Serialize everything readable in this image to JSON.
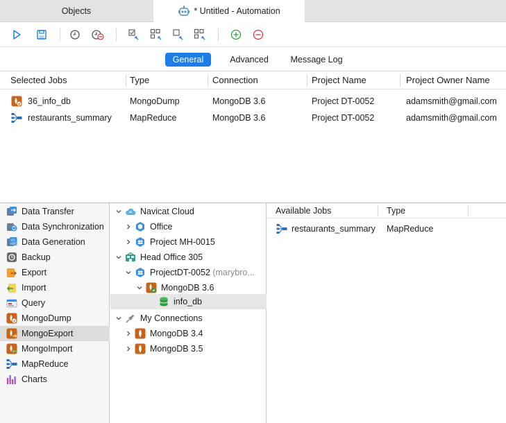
{
  "tabs": [
    {
      "label": "Objects",
      "icon": "none"
    },
    {
      "label": "* Untitled - Automation",
      "icon": "robot-icon"
    }
  ],
  "toolbar": {
    "buttons": [
      "run-icon",
      "save-icon",
      "schedule-icon",
      "delete-schedule-icon",
      "select-all-icon",
      "deselect-all-icon",
      "select-icon",
      "deselect-icon",
      "add-icon",
      "remove-icon"
    ]
  },
  "segments": {
    "general": "General",
    "advanced": "Advanced",
    "message_log": "Message Log",
    "active": "General"
  },
  "jobs_table": {
    "columns": [
      "Selected Jobs",
      "Type",
      "Connection",
      "Project Name",
      "Project Owner Name"
    ],
    "rows": [
      {
        "name": "36_info_db",
        "type": "MongoDump",
        "connection": "MongoDB 3.6",
        "project": "Project DT-0052",
        "owner": "adamsmith@gmail.com",
        "icon": "mongodump-icon"
      },
      {
        "name": "restaurants_summary",
        "type": "MapReduce",
        "connection": "MongoDB 3.6",
        "project": "Project DT-0052",
        "owner": "adamsmith@gmail.com",
        "icon": "mapreduce-icon"
      }
    ]
  },
  "job_types": [
    {
      "label": "Data Transfer",
      "icon": "data-transfer-icon"
    },
    {
      "label": "Data Synchronization",
      "icon": "data-sync-icon"
    },
    {
      "label": "Data Generation",
      "icon": "data-generation-icon"
    },
    {
      "label": "Backup",
      "icon": "backup-icon"
    },
    {
      "label": "Export",
      "icon": "export-icon"
    },
    {
      "label": "Import",
      "icon": "import-icon"
    },
    {
      "label": "Query",
      "icon": "query-icon"
    },
    {
      "label": "MongoDump",
      "icon": "mongodump-icon"
    },
    {
      "label": "MongoExport",
      "icon": "mongoexport-icon",
      "selected": true
    },
    {
      "label": "MongoImport",
      "icon": "mongoimport-icon"
    },
    {
      "label": "MapReduce",
      "icon": "mapreduce-icon"
    },
    {
      "label": "Charts",
      "icon": "charts-icon"
    }
  ],
  "tree": {
    "navicat_cloud": "Navicat Cloud",
    "office": "Office",
    "project_mh": "Project MH-0015",
    "head_office": "Head Office 305",
    "project_dt": "ProjectDT-0052",
    "project_dt_owner": "(marybro...",
    "mongodb_36": "MongoDB 3.6",
    "info_db": "info_db",
    "my_connections": "My Connections",
    "mongodb_34": "MongoDB 3.4",
    "mongodb_35": "MongoDB 3.5"
  },
  "available_jobs": {
    "columns": [
      "Available Jobs",
      "Type"
    ],
    "rows": [
      {
        "name": "restaurants_summary",
        "type": "MapReduce",
        "icon": "mapreduce-icon"
      }
    ]
  },
  "colors": {
    "accent": "#1e7de8",
    "mongo_orange": "#c7641a",
    "green": "#2f9e3f",
    "red": "#d9373c"
  }
}
